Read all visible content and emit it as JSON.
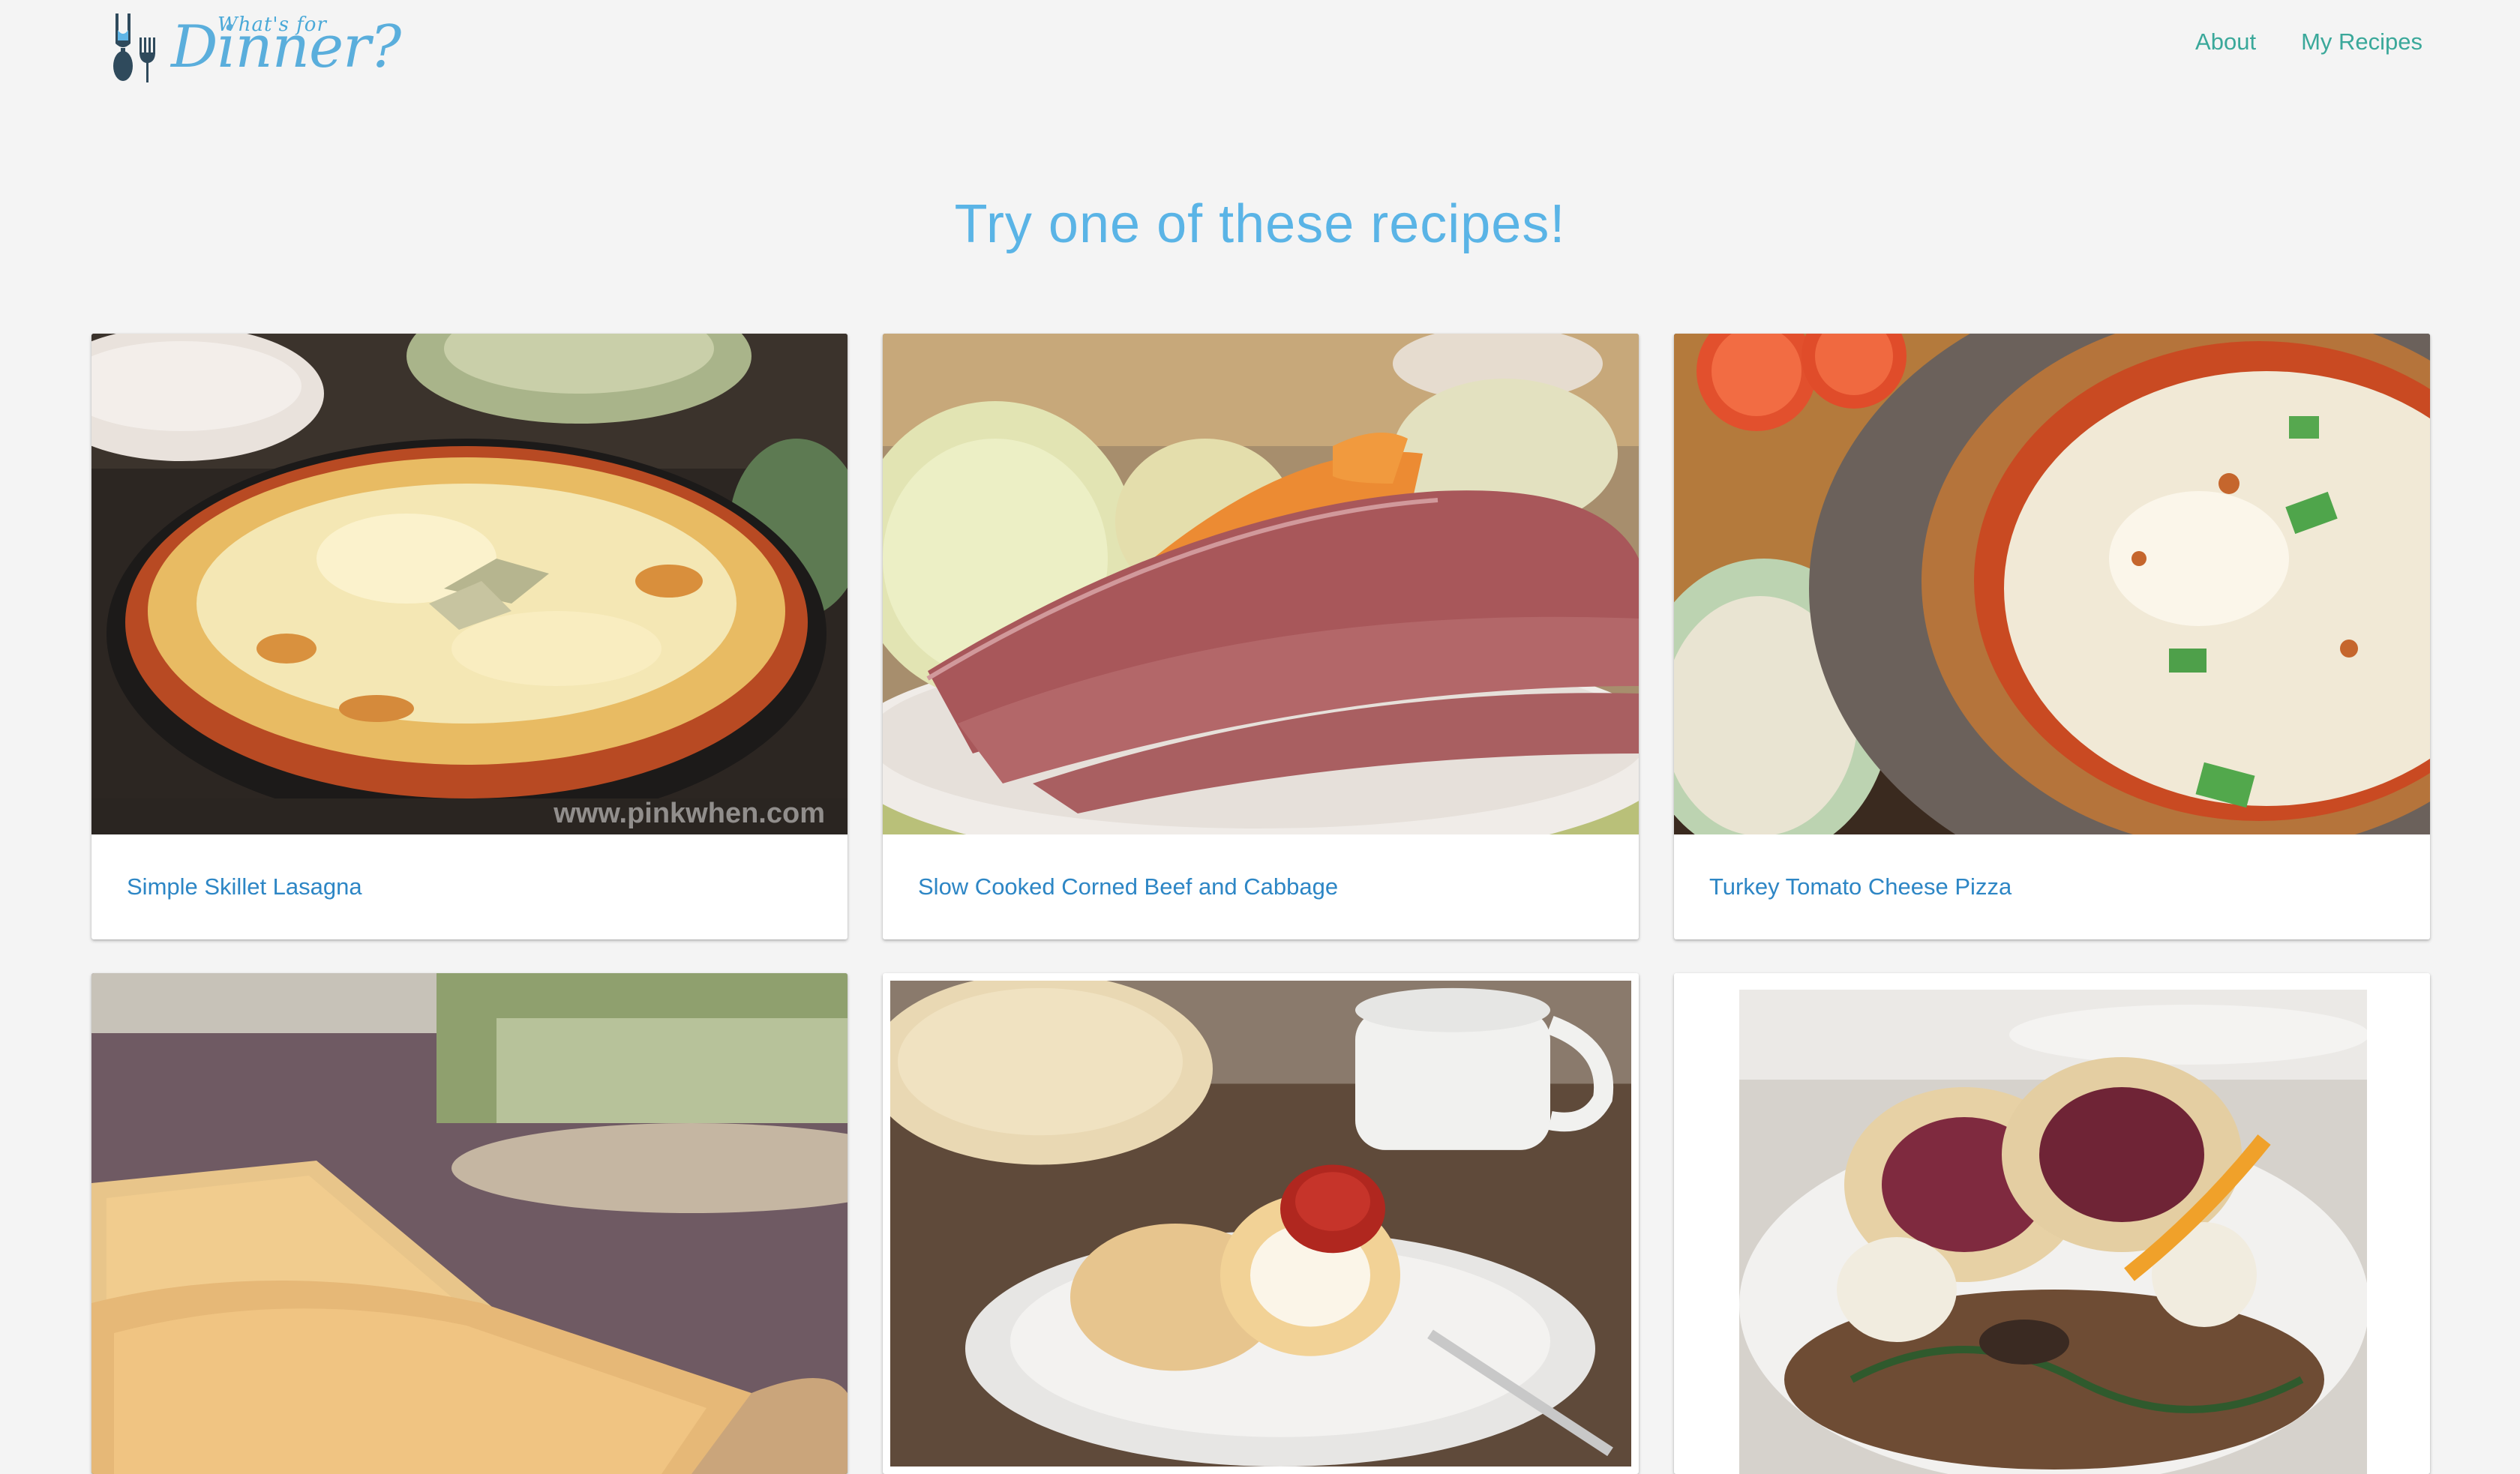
{
  "header": {
    "logo_small": "What's for",
    "logo_big": "Dinner?",
    "nav": [
      {
        "label": "About"
      },
      {
        "label": "My Recipes"
      }
    ]
  },
  "main": {
    "title": "Try one of these recipes!",
    "recipes": [
      {
        "title": "Simple Skillet Lasagna",
        "image": "lasagna-photo",
        "watermark": "www.pinkwhen.com"
      },
      {
        "title": "Slow Cooked Corned Beef and Cabbage",
        "image": "corned-beef-photo"
      },
      {
        "title": "Turkey Tomato Cheese Pizza",
        "image": "pizza-photo"
      },
      {
        "title": "",
        "image": "cheese-scones-photo"
      },
      {
        "title": "",
        "image": "scone-jam-cream-photo"
      },
      {
        "title": "",
        "image": "beef-wellington-photo"
      }
    ]
  },
  "colors": {
    "background": "#f4f4f4",
    "title": "#5ab4e6",
    "nav_link": "#3aa89a",
    "card_link": "#2d86c5"
  }
}
